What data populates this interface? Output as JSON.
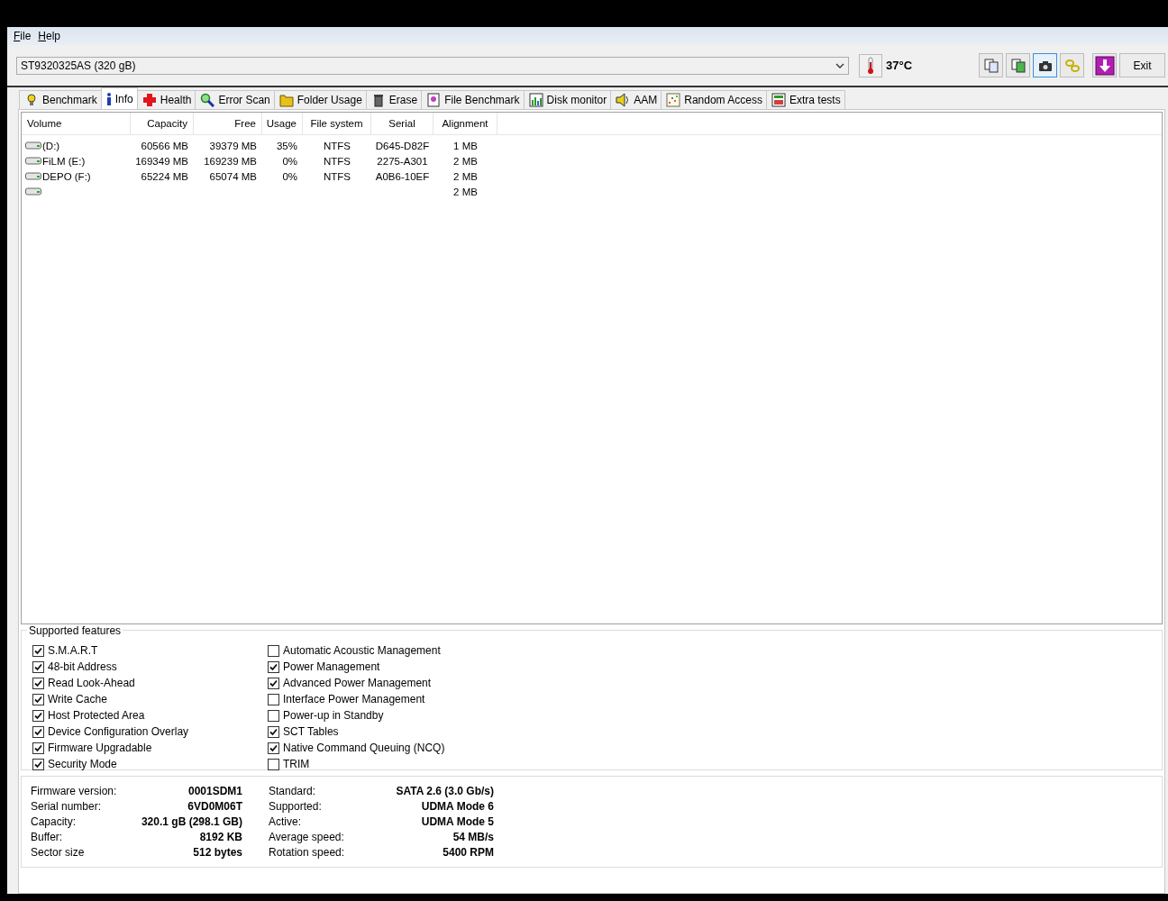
{
  "menu": [
    {
      "label": "File"
    },
    {
      "label": "Help"
    }
  ],
  "toolbar": {
    "drive": "ST9320325AS (320 gB)",
    "temperature": "37°C",
    "buttons": [
      {
        "selected": false
      },
      {
        "selected": false
      },
      {
        "selected": true
      },
      {
        "selected": false
      },
      {
        "selected": false
      }
    ],
    "exit": "Exit"
  },
  "tabs": [
    {
      "label": "Benchmark",
      "selected": false
    },
    {
      "label": "Info",
      "selected": true
    },
    {
      "label": "Health",
      "selected": false
    },
    {
      "label": "Error Scan",
      "selected": false
    },
    {
      "label": "Folder Usage",
      "selected": false
    },
    {
      "label": "Erase",
      "selected": false
    },
    {
      "label": "File Benchmark",
      "selected": false
    },
    {
      "label": "Disk monitor",
      "selected": false
    },
    {
      "label": "AAM",
      "selected": false
    },
    {
      "label": "Random Access",
      "selected": false
    },
    {
      "label": "Extra tests",
      "selected": false
    }
  ],
  "volumes": {
    "columns": [
      "Volume",
      "Capacity",
      "Free",
      "Usage",
      "File system",
      "Serial",
      "Alignment"
    ],
    "rows": [
      [
        "(D:)",
        "60566 MB",
        "39379 MB",
        "35%",
        "NTFS",
        "D645-D82F",
        "1 MB"
      ],
      [
        "FiLM (E:)",
        "169349 MB",
        "169239 MB",
        "0%",
        "NTFS",
        "2275-A301",
        "2 MB"
      ],
      [
        "DEPO (F:)",
        "65224 MB",
        "65074 MB",
        "0%",
        "NTFS",
        "A0B6-10EF",
        "2 MB"
      ],
      [
        "",
        "",
        "",
        "",
        "",
        "",
        "2 MB"
      ]
    ]
  },
  "features": {
    "title": "Supported features",
    "items": [
      {
        "label": "S.M.A.R.T",
        "checked": true
      },
      {
        "label": "48-bit Address",
        "checked": true
      },
      {
        "label": "Read Look-Ahead",
        "checked": true
      },
      {
        "label": "Write Cache",
        "checked": true
      },
      {
        "label": "Host Protected Area",
        "checked": true
      },
      {
        "label": "Device Configuration Overlay",
        "checked": true
      },
      {
        "label": "Firmware Upgradable",
        "checked": true
      },
      {
        "label": "Security Mode",
        "checked": true
      },
      {
        "label": "Automatic Acoustic Management",
        "checked": false
      },
      {
        "label": "Power Management",
        "checked": true
      },
      {
        "label": "Advanced Power Management",
        "checked": true
      },
      {
        "label": "Interface Power Management",
        "checked": false
      },
      {
        "label": "Power-up in Standby",
        "checked": false
      },
      {
        "label": "SCT Tables",
        "checked": true
      },
      {
        "label": "Native Command Queuing (NCQ)",
        "checked": true
      },
      {
        "label": "TRIM",
        "checked": false
      }
    ]
  },
  "details": {
    "left": [
      {
        "label": "Firmware version:",
        "value": "0001SDM1"
      },
      {
        "label": "Serial number:",
        "value": "6VD0M06T"
      },
      {
        "label": "Capacity:",
        "value": "320.1 gB (298.1 GB)"
      },
      {
        "label": "Buffer:",
        "value": "8192 KB"
      },
      {
        "label": "Sector size",
        "value": "512 bytes"
      }
    ],
    "right": [
      {
        "label": "Standard:",
        "value": "SATA 2.6 (3.0 Gb/s)"
      },
      {
        "label": "Supported:",
        "value": "UDMA Mode 6"
      },
      {
        "label": "Active:",
        "value": "UDMA Mode 5"
      },
      {
        "label": "Average speed:",
        "value": "54 MB/s"
      },
      {
        "label": "Rotation speed:",
        "value": "5400 RPM"
      }
    ]
  }
}
